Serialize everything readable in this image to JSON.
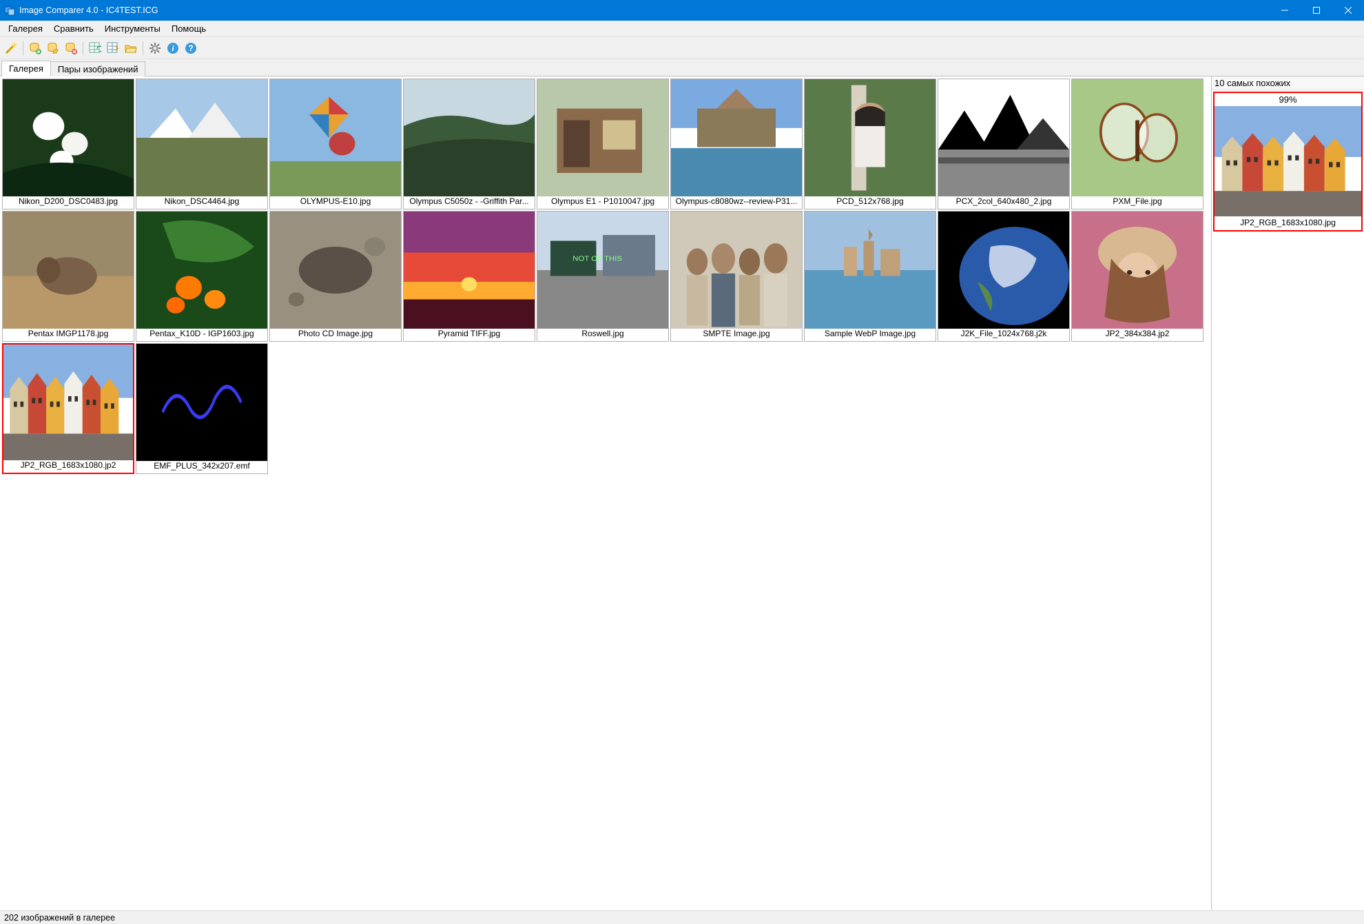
{
  "window": {
    "title": "Image Comparer 4.0 - IC4TEST.ICG"
  },
  "menu": {
    "items": [
      "Галерея",
      "Сравнить",
      "Инструменты",
      "Помощь"
    ]
  },
  "toolbar": {
    "buttons": [
      "wizard-icon",
      "|",
      "db-add-icon",
      "db-open-icon",
      "db-close-icon",
      "|",
      "grid-refresh-icon",
      "grid-sort-icon",
      "folder-open-icon",
      "|",
      "gear-icon",
      "info-icon",
      "help-icon"
    ]
  },
  "tabs": {
    "items": [
      {
        "label": "Галерея",
        "active": true
      },
      {
        "label": "Пары изображений",
        "active": false
      }
    ]
  },
  "gallery": {
    "items": [
      {
        "label": "Nikon_D200_DSC0483.jpg",
        "selected": false,
        "kind": "flowers"
      },
      {
        "label": "Nikon_DSC4464.jpg",
        "selected": false,
        "kind": "mountain"
      },
      {
        "label": "OLYMPUS-E10.jpg",
        "selected": false,
        "kind": "kite"
      },
      {
        "label": "Olympus C5050z  -  -Griffith Par...",
        "selected": false,
        "kind": "landscape2"
      },
      {
        "label": "Olympus E1 - P1010047.jpg",
        "selected": false,
        "kind": "shop"
      },
      {
        "label": "Olympus-c8080wz--review-P31...",
        "selected": false,
        "kind": "botanic"
      },
      {
        "label": "PCD_512x768.jpg",
        "selected": false,
        "kind": "woman"
      },
      {
        "label": "PCX_2col_640x480_2.jpg",
        "selected": false,
        "kind": "bw"
      },
      {
        "label": "PXM_File.jpg",
        "selected": false,
        "kind": "butterfly"
      },
      {
        "label": "Pentax IMGP1178.jpg",
        "selected": false,
        "kind": "animal"
      },
      {
        "label": "Pentax_K10D - IGP1603.jpg",
        "selected": false,
        "kind": "orange"
      },
      {
        "label": "Photo CD Image.jpg",
        "selected": false,
        "kind": "rock"
      },
      {
        "label": "Pyramid TIFF.jpg",
        "selected": false,
        "kind": "sunset"
      },
      {
        "label": "Roswell.jpg",
        "selected": false,
        "kind": "street"
      },
      {
        "label": "SMPTE Image.jpg",
        "selected": false,
        "kind": "crowd"
      },
      {
        "label": "Sample WebP Image.jpg",
        "selected": false,
        "kind": "venice"
      },
      {
        "label": "J2K_File_1024x768.j2k",
        "selected": false,
        "kind": "earth"
      },
      {
        "label": "JP2_384x384.jp2",
        "selected": false,
        "kind": "lena"
      },
      {
        "label": "JP2_RGB_1683x1080.jp2",
        "selected": true,
        "kind": "bergen"
      },
      {
        "label": "EMF_PLUS_342x207.emf",
        "selected": false,
        "kind": "sig"
      }
    ]
  },
  "side": {
    "header": "10 самых похожих",
    "match": {
      "percent": "99%",
      "label": "JP2_RGB_1683x1080.jpg",
      "kind": "bergen"
    }
  },
  "status": {
    "text": "202 изображений в галерее"
  }
}
